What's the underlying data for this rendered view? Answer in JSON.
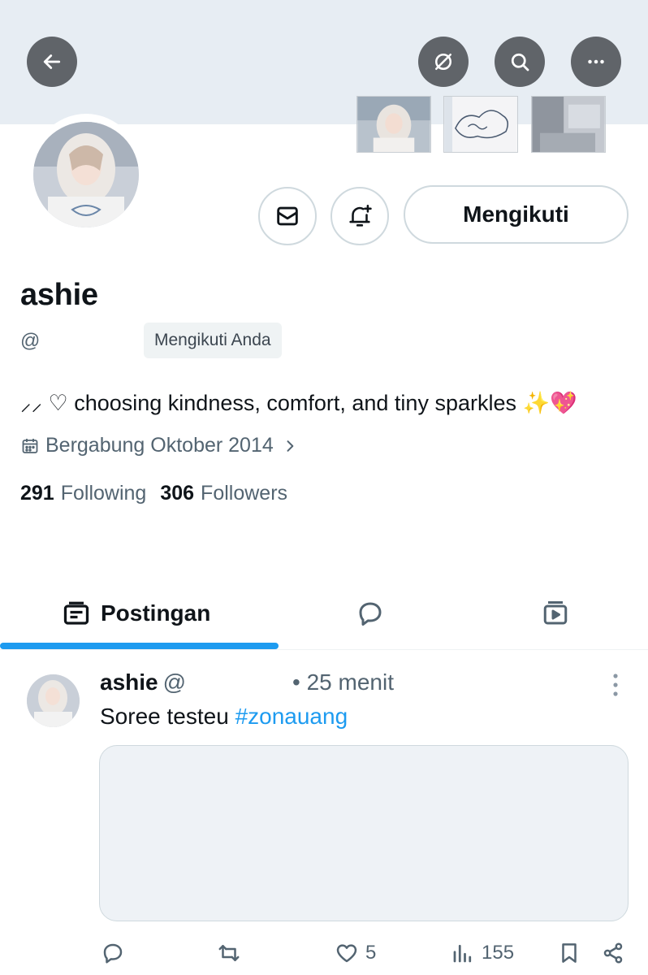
{
  "header": {
    "back_icon": "arrow-left-icon",
    "grok_icon": "grok-icon",
    "search_icon": "search-icon",
    "more_icon": "more-horizontal-icon"
  },
  "profile": {
    "display_name": "ashie",
    "handle": "@",
    "follows_you_badge": "Mengikuti Anda",
    "bio_text": "⸝⸝ ♡ choosing kindness, comfort, and tiny sparkles ",
    "bio_sparkle": "✨",
    "bio_heart": "💖",
    "joined": "Bergabung Oktober 2014",
    "following_count": "291",
    "following_label": "Following",
    "followers_count": "306",
    "followers_label": "Followers"
  },
  "actions": {
    "follow_button": "Mengikuti",
    "message_icon": "envelope-icon",
    "notify_icon": "bell-plus-icon"
  },
  "tabs": {
    "posts_label": "Postingan",
    "replies_icon": "speech-bubble-icon",
    "media_icon": "video-icon"
  },
  "post": {
    "name": "ashie",
    "handle": "@",
    "time": "• 25 menit",
    "text": "Soree testeu ",
    "hashtag": "#zonauang",
    "likes": "5",
    "views": "155"
  },
  "colors": {
    "accent": "#1d9bf0",
    "banner": "#e7edf3",
    "secondary_text": "#536471"
  }
}
